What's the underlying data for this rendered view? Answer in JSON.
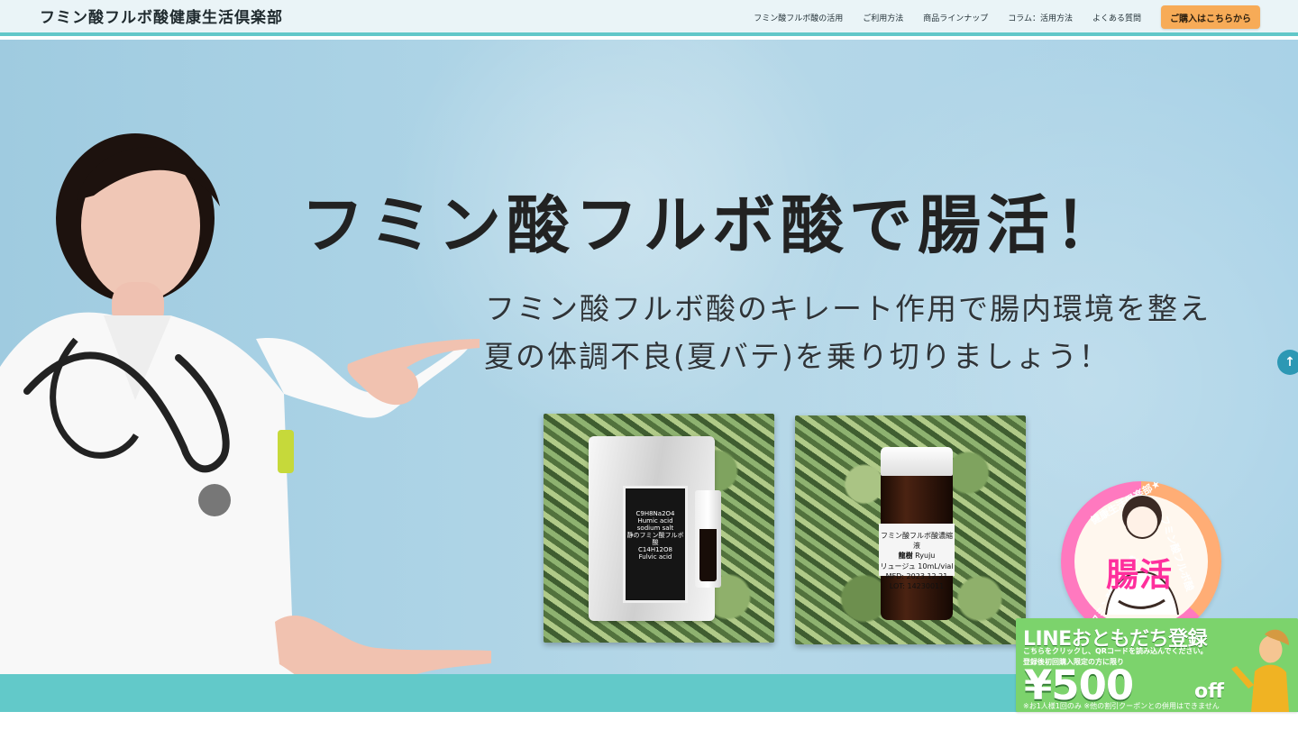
{
  "header": {
    "site_title": "フミン酸フルボ酸健康生活倶楽部",
    "nav": {
      "humic_fulvic_use": "フミン酸フルボ酸の活用",
      "usage": "ご利用方法",
      "lineup": "商品ラインナップ",
      "column": "コラム：活用方法",
      "faq": "よくある質問",
      "buy_button": "ご購入はこちらから"
    }
  },
  "hero": {
    "headline": "フミン酸フルボ酸で腸活！",
    "subline_1": "フミン酸フルボ酸のキレート作用で腸内環境を整え",
    "subline_2": "夏の体調不良(夏バテ)を乗り切りましょう！"
  },
  "products": {
    "pouch": {
      "formula_top": "C9H8Na2O4",
      "formula_bottom": "C14H12O8",
      "label_small": "Humic acid sodium salt",
      "label_middle": "静のフミン酸フルボ酸",
      "label_footer": "Fulvic acid"
    },
    "bottle": {
      "label_top": "フミン酸フルボ酸濃縮液",
      "name_jp": "龍樹",
      "name_en": "Ryuju",
      "volume": "リュージュ 10mL/vial",
      "date": "MFD: 2023.12.21",
      "lot": "LOT: 14230011"
    }
  },
  "badge": {
    "main_text": "腸活",
    "ring_left": "フミン酸フルボ酸",
    "ring_right": "フミン酸フルボ酸",
    "ring_top": "健康生活倶楽部★"
  },
  "line_banner": {
    "title": "LINEおともだち登録",
    "note_1": "こちらをクリックし、QRコードを読み込んでください。",
    "note_2": "登録後初回購入限定の方に限り",
    "price": "¥500",
    "off": "off",
    "note_3": "※お1人様1回のみ ※他の割引クーポンとの併用はできません"
  },
  "ui": {
    "scroll_top_icon": "arrow-up-icon"
  },
  "colors": {
    "header_background": "#eaf4f7",
    "accent_teal": "#62c9c9",
    "buy_button": "#f7ab57",
    "line_green": "#7cd36c",
    "badge_pink": "#ff2f9d"
  }
}
